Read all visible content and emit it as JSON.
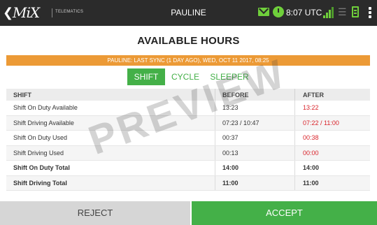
{
  "topbar": {
    "back_glyph": "❮",
    "logo_text": "MiX",
    "logo_sub": "TELEMATICS",
    "title": "PAULINE",
    "time": "8:07 UTC",
    "icons": [
      "back-icon",
      "mail-icon",
      "clock-icon",
      "signal-icon",
      "wifi-icon",
      "battery-icon",
      "menu-icon"
    ],
    "accent": "#6fcf3b"
  },
  "page_title": "AVAILABLE HOURS",
  "sync_text": "PAULINE: LAST SYNC (1 DAY AGO), WED, OCT 11 2017, 08:25",
  "tabs": [
    {
      "label": "SHIFT",
      "active": true
    },
    {
      "label": "CYCLE",
      "active": false
    },
    {
      "label": "SLEEPER",
      "active": false
    }
  ],
  "table": {
    "headers": [
      "SHIFT",
      "BEFORE",
      "AFTER"
    ],
    "rows": [
      {
        "label": "Shift On Duty Available",
        "before": "13:23",
        "after": "13:22"
      },
      {
        "label": "Shift Driving Available",
        "before": "07:23 / 10:47",
        "after": "07:22 / 11:00"
      },
      {
        "label": "Shift On Duty Used",
        "before": "00:37",
        "after": "00:38"
      },
      {
        "label": "Shift Driving Used",
        "before": "00:13",
        "after": "00:00"
      },
      {
        "label": "Shift On Duty Total",
        "before": "14:00",
        "after": "14:00"
      },
      {
        "label": "Shift Driving Total",
        "before": "11:00",
        "after": "11:00"
      }
    ]
  },
  "watermark": "PREVIEW",
  "buttons": {
    "reject": "REJECT",
    "accept": "ACCEPT"
  },
  "colors": {
    "green": "#44b048",
    "orange": "#ec9a36",
    "red": "#d9232a",
    "topbar": "#2b2b2b"
  }
}
